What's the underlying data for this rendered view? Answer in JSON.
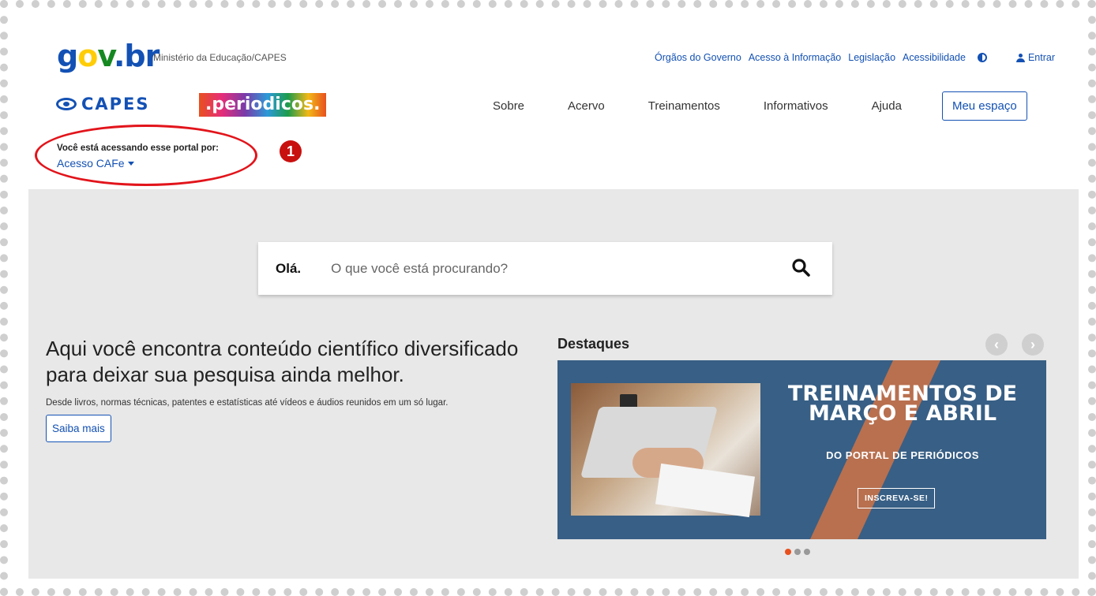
{
  "header": {
    "govbr_logo": "gov.br",
    "ministry": "Ministério da Educação/CAPES",
    "top_links": [
      "Órgãos do Governo",
      "Acesso à Informação",
      "Legislação",
      "Acessibilidade"
    ],
    "contrast_icon": "contrast-icon",
    "login_label": "Entrar",
    "capes_logo": "CAPES",
    "periodicos_logo": ".periodicos.",
    "nav": [
      "Sobre",
      "Acervo",
      "Treinamentos",
      "Informativos",
      "Ajuda"
    ],
    "my_space_label": "Meu espaço",
    "access": {
      "label": "Você está acessando esse portal por:",
      "value": "Acesso CAFe"
    }
  },
  "annotation": {
    "step_number": "1",
    "ring_color": "#e2141b"
  },
  "search": {
    "greeting": "Olá.",
    "placeholder": "O que você está procurando?"
  },
  "hero": {
    "title": "Aqui você encontra conteúdo científico diversificado para deixar sua pesquisa ainda melhor.",
    "subtitle": "Desde livros, normas técnicas, patentes e estatísticas até vídeos e áudios reunidos em um só lugar.",
    "cta_label": "Saiba mais"
  },
  "highlights": {
    "title": "Destaques",
    "banner_title": "TREINAMENTOS DE MARÇO E ABRIL",
    "banner_sub": "DO PORTAL DE PERIÓDICOS",
    "banner_button": "INSCREVA-SE!",
    "slide_count": 3,
    "active_slide": 1
  },
  "colors": {
    "primary": "#1351b4",
    "background": "#e8e8e8",
    "banner": "#385f85",
    "banner_stripe": "#b8704f"
  }
}
